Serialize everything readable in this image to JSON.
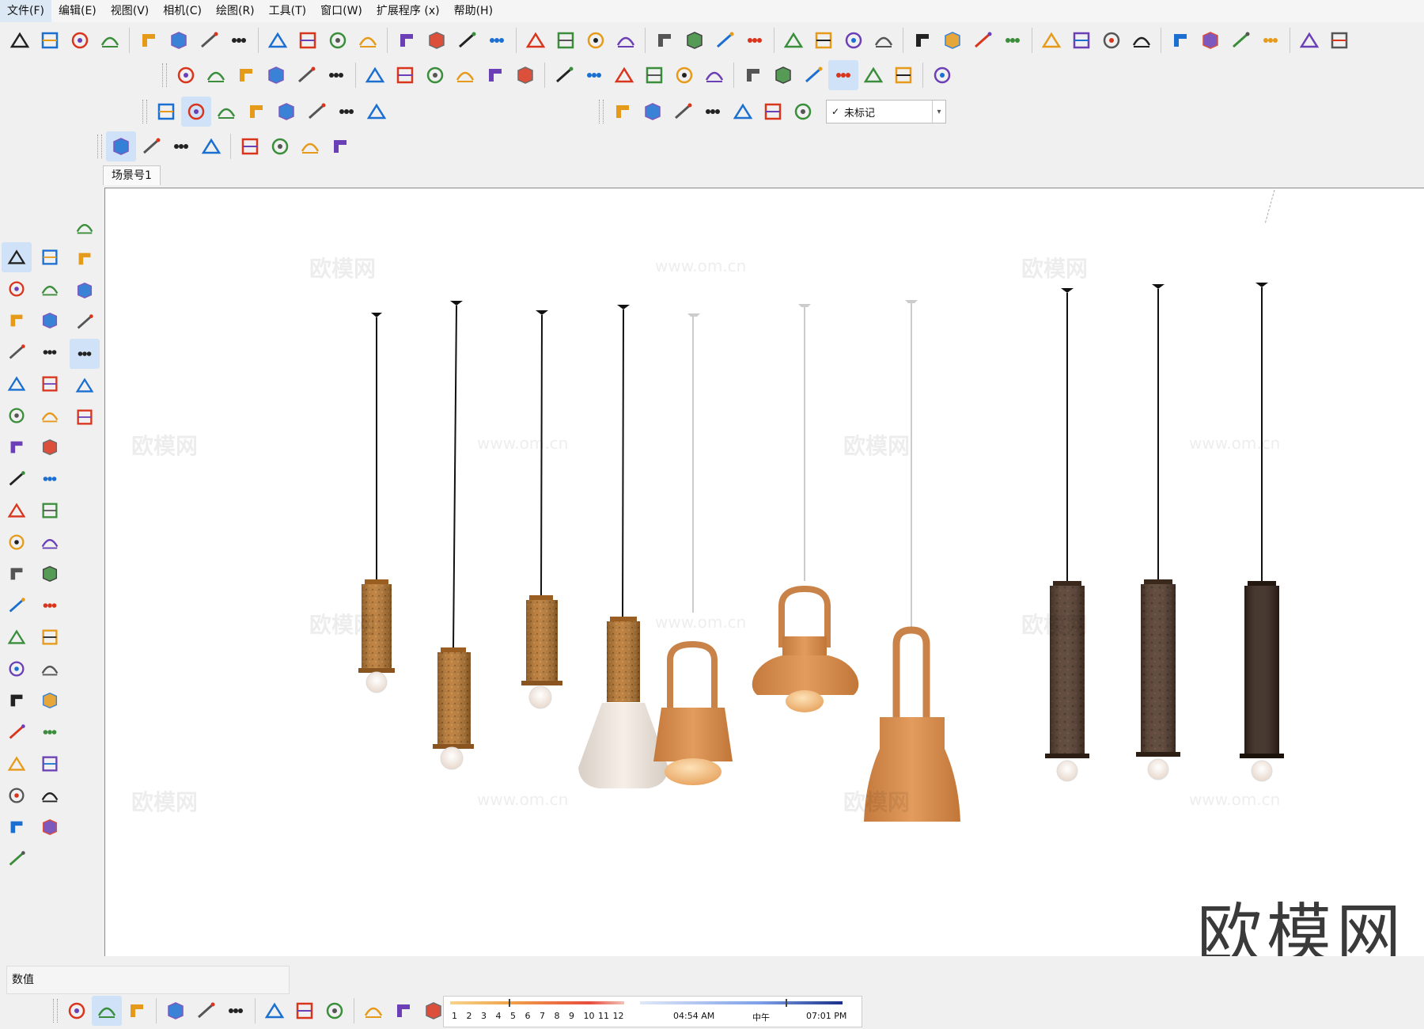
{
  "menu": [
    "文件(F)",
    "编辑(E)",
    "视图(V)",
    "相机(C)",
    "绘图(R)",
    "工具(T)",
    "窗口(W)",
    "扩展程序 (x)",
    "帮助(H)"
  ],
  "scene_tab": "场景号1",
  "tag_dropdown": {
    "checkmark": "✓",
    "selected": "未标记"
  },
  "value_label": "数值",
  "watermark_text": "欧模网",
  "watermark_url": "www.om.cn",
  "logo_text": "欧模网",
  "shadow": {
    "months": [
      "1",
      "2",
      "3",
      "4",
      "5",
      "6",
      "7",
      "8",
      "9",
      "10",
      "11",
      "12"
    ],
    "time_start": "04:54 AM",
    "time_mid": "中午",
    "time_end": "07:01 PM"
  },
  "colors": {
    "cork": "#b8762e",
    "terracotta": "#d48b4a",
    "cream": "#efe6dc",
    "dark_wood": "#4a3224",
    "accent_blue": "#1a6fd1"
  },
  "icons": {
    "toolbar_row1": [
      "sandbox-icon",
      "section-icon",
      "follow-me-icon",
      "bar-chart-icon",
      "intersect-icon",
      "offset-line-icon",
      "smooth-icon",
      "curve-icon",
      "arch-icon",
      "loop-icon",
      "scatter-icon",
      "wall-icon",
      "pen-node-icon",
      "flatten-icon",
      "layers-icon",
      "component-icon",
      "roof-icon",
      "arc-icon",
      "dots-icon",
      "wave-icon",
      "spiral-icon",
      "stairs-icon",
      "railing-icon",
      "columns-icon",
      "mirror-icon",
      "grid-icon",
      "box-icon",
      "compass-icon",
      "brush-icon",
      "sun-icon",
      "render-icon",
      "open-folder-icon",
      "check-icon",
      "cloud-upload-icon",
      "cube-export-icon",
      "refresh-icon",
      "house-icon",
      "shed-icon",
      "home-icon",
      "roof-house-icon",
      "outline-house-icon",
      "warehouse-icon"
    ],
    "toolbar_row2": [
      "line-tool-icon",
      "ruler-icon",
      "push-icon",
      "shovel-icon",
      "box3d-icon",
      "cylinder-icon",
      "plane-icon",
      "tube-icon",
      "cross-icon",
      "twist-icon",
      "frame-icon",
      "frame2-icon",
      "stack-icon",
      "xray-icon",
      "wire-icon",
      "hidden-line-icon",
      "shaded-icon",
      "texture-icon",
      "mono-icon",
      "iso-icon",
      "top-icon",
      "front-icon",
      "right-icon",
      "back-icon",
      "left-icon"
    ],
    "toolbar_row3": [
      "play-icon",
      "pause-icon",
      "record-icon",
      "stop-icon",
      "settings-icon",
      "film-icon",
      "film-off-icon",
      "help-icon"
    ],
    "toolbar_row3b": [
      "p-plugin-icon",
      "orbit-icon",
      "video-icon",
      "camera-icon",
      "y-axis-icon",
      "gear-flower-icon",
      "cube-tag-icon"
    ],
    "toolbar_row4": [
      "cloud-wave-icon",
      "cloud-link-icon",
      "cloud-check-icon",
      "cloud-sync-icon",
      "frame-select-icon",
      "scatter-dots-icon",
      "clock-check-icon",
      "chrome-icon"
    ],
    "left_palette": [
      "select-icon",
      "make-component-icon",
      "eraser-icon",
      "pencil-icon",
      "freehand-icon",
      "rectangle-icon",
      "rotated-rect-icon",
      "circle-icon",
      "polygon-icon",
      "arc-icon",
      "pie-icon",
      "arc3-icon",
      "pie2-icon",
      "move-icon",
      "push-pull-icon",
      "rotate-icon",
      "follow-me-icon",
      "scale-icon",
      "offset-icon",
      "tape-icon",
      "dimension-icon",
      "protractor-icon",
      "text-icon",
      "axes-icon",
      "3d-text-icon",
      "orbit-icon",
      "pan-icon",
      "zoom-icon",
      "zoom-window-icon",
      "zoom-extents-icon",
      "previous-icon",
      "position-camera-icon",
      "look-around-icon",
      "walk-icon",
      "section-plane-icon",
      "sandbox-icon",
      "stamp-icon",
      "layers-toggle-icon",
      "smoove-icon"
    ],
    "left_palette2": [
      "download-icon",
      "export-icon",
      "paint-bucket-icon",
      "gear-icon",
      "select2-icon",
      "component2-icon",
      "eraser2-icon"
    ],
    "bottom": [
      "e-plugin-icon",
      "refresh-icon",
      "arrows-icon",
      "plus-icon",
      "tree-icon",
      "fan-icon",
      "checker-icon",
      "cloud-up-icon",
      "gears-icon",
      "mail-icon",
      "info-icon",
      "eraser-shade-icon"
    ]
  }
}
